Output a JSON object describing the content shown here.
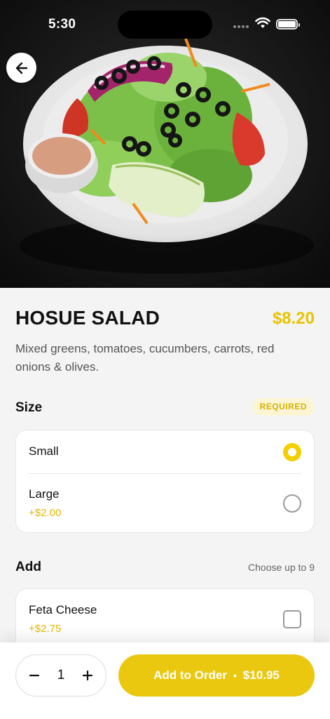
{
  "status_bar": {
    "time": "5:30"
  },
  "item": {
    "name": "HOSUE SALAD",
    "price": "$8.20",
    "description": "Mixed greens, tomatoes, cucumbers, carrots, red onions & olives."
  },
  "size_section": {
    "title": "Size",
    "badge": "REQUIRED",
    "options": [
      {
        "name": "Small",
        "price": "",
        "selected": true
      },
      {
        "name": "Large",
        "price": "+$2.00",
        "selected": false
      }
    ]
  },
  "add_section": {
    "title": "Add",
    "hint": "Choose up to 9",
    "options": [
      {
        "name": "Feta Cheese",
        "price": "+$2.75",
        "checked": false
      }
    ]
  },
  "bottom_bar": {
    "quantity": "1",
    "add_label": "Add to Order",
    "separator": "•",
    "total": "$10.95"
  },
  "colors": {
    "accent": "#eac80f",
    "price_text": "#e9c400"
  }
}
